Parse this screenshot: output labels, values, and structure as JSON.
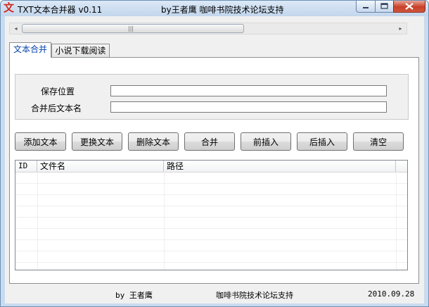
{
  "window": {
    "app_icon_glyph": "文",
    "title": "TXT文本合并器 v0.11",
    "title_credit": "by王者鹰 咖啡书院技术论坛支持"
  },
  "scrollbar": {
    "left_arrow": "◂",
    "right_arrow": "▸",
    "grip": "|||"
  },
  "tabs": [
    {
      "label": "文本合并",
      "active": true
    },
    {
      "label": "小说下载阅读",
      "active": false
    }
  ],
  "form": {
    "save_location_label": "保存位置",
    "save_location_value": "",
    "merged_name_label": "合并后文本名",
    "merged_name_value": ""
  },
  "buttons": {
    "add": "添加文本",
    "replace": "更换文本",
    "delete": "删除文本",
    "merge": "合并",
    "insert_before": "前插入",
    "insert_after": "后插入",
    "clear": "清空"
  },
  "list": {
    "columns": [
      "ID",
      "文件名",
      "路径"
    ],
    "rows": []
  },
  "status": {
    "author": "by 王者鹰",
    "forum": "咖啡书院技术论坛支持",
    "date": "2010.09.28"
  },
  "colors": {
    "title_accent": "#d4261c",
    "active_tab_text": "#0645ad",
    "close_button": "#c7412a"
  }
}
